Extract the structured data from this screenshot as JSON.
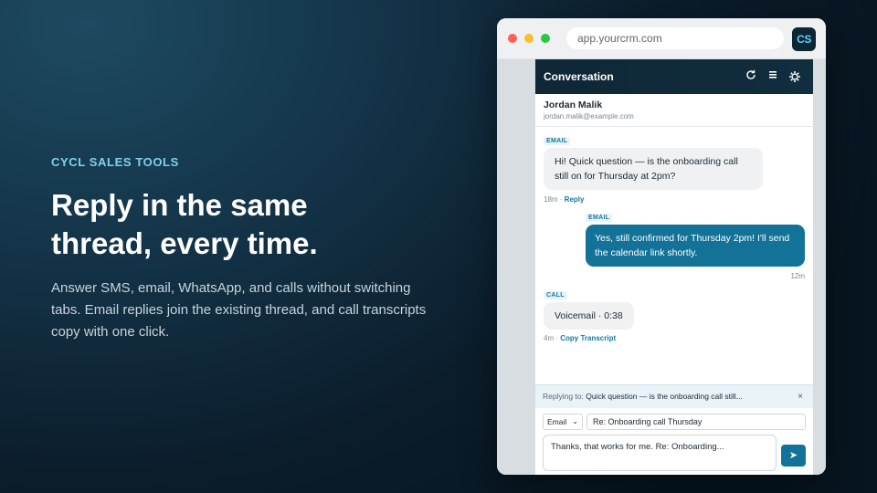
{
  "hero": {
    "eyebrow": "CYCL SALES TOOLS",
    "headline": "Reply in the same thread, every time.",
    "subcopy": "Answer SMS, email, WhatsApp, and calls without switching tabs. Email replies join the existing thread, and call transcripts copy with one click."
  },
  "browser": {
    "url": "app.yourcrm.com",
    "logo_text": "CS"
  },
  "panel": {
    "title": "Conversation",
    "icons": [
      "refresh-icon",
      "list-icon",
      "gear-icon"
    ],
    "contact": {
      "name": "Jordan Malik",
      "email": "jordan.malik@example.com"
    }
  },
  "messages": [
    {
      "channel": "EMAIL",
      "direction": "in",
      "text": "Hi! Quick question — is the onboarding call still on for Thursday at 2pm?",
      "time": "18m",
      "action": "Reply"
    },
    {
      "channel": "EMAIL",
      "direction": "out",
      "text": "Yes, still confirmed for Thursday 2pm! I'll send the calendar link shortly.",
      "time": "12m"
    },
    {
      "channel": "CALL",
      "direction": "in",
      "text": "Voicemail · 0:38",
      "time": "4m",
      "action": "Copy Transcript"
    }
  ],
  "reply_bar": {
    "label": "Replying to:",
    "text": "Quick question — is the onboarding call still...",
    "close": "×"
  },
  "composer": {
    "channel_value": "Email",
    "subject_value": "Re: Onboarding call Thursday",
    "body_value": "Thanks, that works for me. Re: Onboarding...",
    "send_icon": "send-icon"
  },
  "colors": {
    "accent": "#137297",
    "eyebrow": "#7fd2ee",
    "header": "#0f2736"
  }
}
